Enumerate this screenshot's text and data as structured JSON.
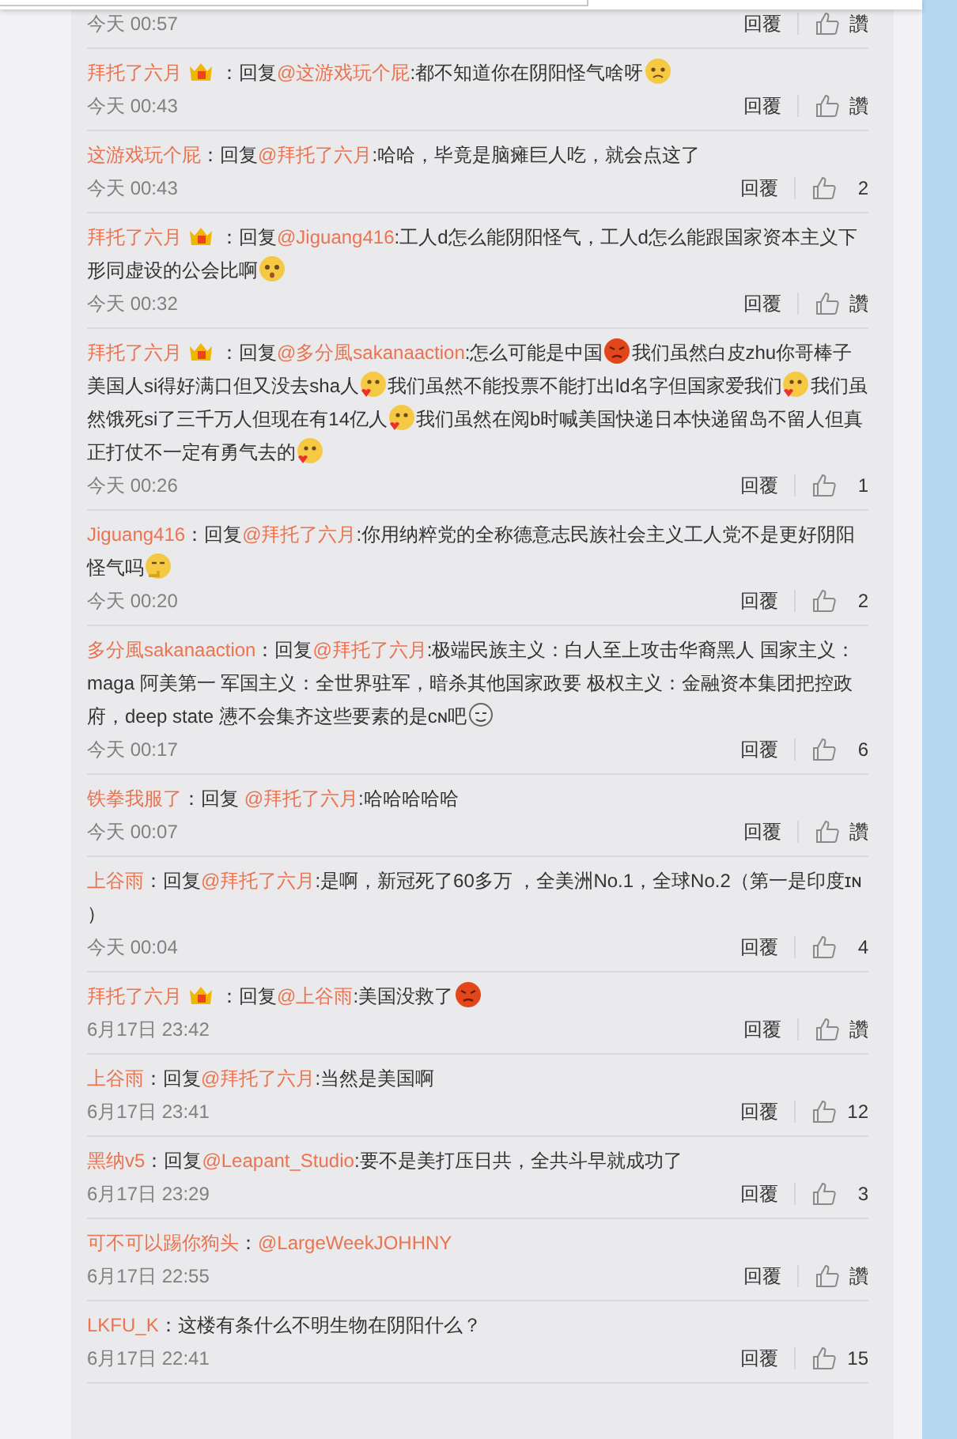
{
  "top_footer": {
    "time": "今天 00:57",
    "reply": "回覆",
    "likes": "讚"
  },
  "comments": [
    {
      "author": "拜托了六月",
      "badge": true,
      "segments": [
        {
          "kind": "text",
          "text": "：回复"
        },
        {
          "kind": "mention",
          "text": "@这游戏玩个屁"
        },
        {
          "kind": "text",
          "text": ":都不知道你在阴阳怪气啥呀"
        },
        {
          "kind": "sad"
        }
      ],
      "time": "今天 00:43",
      "reply": "回覆",
      "likes": "讚"
    },
    {
      "author": "这游戏玩个屁",
      "badge": false,
      "segments": [
        {
          "kind": "text",
          "text": "：回复"
        },
        {
          "kind": "mention",
          "text": "@拜托了六月"
        },
        {
          "kind": "text",
          "text": ":哈哈，毕竟是脑瘫巨人吃，就会点这了"
        }
      ],
      "time": "今天 00:43",
      "reply": "回覆",
      "likes": "2"
    },
    {
      "author": "拜托了六月",
      "badge": true,
      "segments": [
        {
          "kind": "text",
          "text": "：回复"
        },
        {
          "kind": "mention",
          "text": "@Jiguang416"
        },
        {
          "kind": "text",
          "text": ":工人d怎么能阴阳怪气，工人d怎么能跟国家资本主义下形同虚设的公会比啊"
        },
        {
          "kind": "shy"
        }
      ],
      "time": "今天 00:32",
      "reply": "回覆",
      "likes": "讚"
    },
    {
      "author": "拜托了六月",
      "badge": true,
      "segments": [
        {
          "kind": "text",
          "text": "：回复"
        },
        {
          "kind": "mention",
          "text": "@多分風sakanaaction"
        },
        {
          "kind": "text",
          "text": ":怎么可能是中国"
        },
        {
          "kind": "angry"
        },
        {
          "kind": "text",
          "text": "我们虽然白皮zhu你哥棒子美国人si得好满口但又没去sha人"
        },
        {
          "kind": "love"
        },
        {
          "kind": "text",
          "text": "我们虽然不能投票不能打出ld名字但国家爱我们"
        },
        {
          "kind": "love"
        },
        {
          "kind": "text",
          "text": "我们虽然饿死si了三千万人但现在有14亿人"
        },
        {
          "kind": "love"
        },
        {
          "kind": "text",
          "text": "我们虽然在阅b时喊美国快递日本快递留岛不留人但真正打仗不一定有勇气去的"
        },
        {
          "kind": "love"
        }
      ],
      "time": "今天 00:26",
      "reply": "回覆",
      "likes": "1"
    },
    {
      "author": "Jiguang416",
      "badge": false,
      "segments": [
        {
          "kind": "text",
          "text": "：回复"
        },
        {
          "kind": "mention",
          "text": "@拜托了六月"
        },
        {
          "kind": "text",
          "text": ":你用纳粹党的全称德意志民族社会主义工人党不是更好阴阳怪气吗"
        },
        {
          "kind": "think"
        }
      ],
      "time": "今天 00:20",
      "reply": "回覆",
      "likes": "2"
    },
    {
      "author": "多分風sakanaaction",
      "badge": false,
      "segments": [
        {
          "kind": "text",
          "text": "：回复"
        },
        {
          "kind": "mention",
          "text": "@拜托了六月"
        },
        {
          "kind": "text",
          "text": ":极端民族主义：白人至上攻击华裔黑人 国家主义：maga 阿美第一 军国主义：全世界驻军，暗杀其他国家政要 极权主义：金融资本集团把控政府，deep state 懑不会集齐这些要素的是ᴄɴ吧"
        },
        {
          "kind": "smirk"
        }
      ],
      "time": "今天 00:17",
      "reply": "回覆",
      "likes": "6"
    },
    {
      "author": "铁拳我服了",
      "badge": false,
      "segments": [
        {
          "kind": "text",
          "text": "：回复 "
        },
        {
          "kind": "mention",
          "text": "@拜托了六月"
        },
        {
          "kind": "text",
          "text": ":哈哈哈哈哈"
        }
      ],
      "time": "今天 00:07",
      "reply": "回覆",
      "likes": "讚"
    },
    {
      "author": "上谷雨",
      "badge": false,
      "segments": [
        {
          "kind": "text",
          "text": "：回复"
        },
        {
          "kind": "mention",
          "text": "@拜托了六月"
        },
        {
          "kind": "text",
          "text": ":是啊，新冠死了60多万 ，全美洲No.1，全球No.2（第一是印度ɪɴ ）"
        }
      ],
      "time": "今天 00:04",
      "reply": "回覆",
      "likes": "4"
    },
    {
      "author": "拜托了六月",
      "badge": true,
      "segments": [
        {
          "kind": "text",
          "text": "：回复"
        },
        {
          "kind": "mention",
          "text": "@上谷雨"
        },
        {
          "kind": "text",
          "text": ":美国没救了"
        },
        {
          "kind": "angry"
        }
      ],
      "time": "6月17日 23:42",
      "reply": "回覆",
      "likes": "讚"
    },
    {
      "author": "上谷雨",
      "badge": false,
      "segments": [
        {
          "kind": "text",
          "text": "：回复"
        },
        {
          "kind": "mention",
          "text": "@拜托了六月"
        },
        {
          "kind": "text",
          "text": ":当然是美国啊"
        }
      ],
      "time": "6月17日 23:41",
      "reply": "回覆",
      "likes": "12"
    },
    {
      "author": "黑纳v5",
      "badge": false,
      "segments": [
        {
          "kind": "text",
          "text": "：回复"
        },
        {
          "kind": "mention",
          "text": "@Leapant_Studio"
        },
        {
          "kind": "text",
          "text": ":要不是美打压日共，全共斗早就成功了"
        }
      ],
      "time": "6月17日 23:29",
      "reply": "回覆",
      "likes": "3"
    },
    {
      "author": "可不可以踢你狗头",
      "badge": false,
      "segments": [
        {
          "kind": "text",
          "text": "："
        },
        {
          "kind": "mention",
          "text": "@LargeWeekJOHHNY"
        }
      ],
      "time": "6月17日 22:55",
      "reply": "回覆",
      "likes": "讚"
    },
    {
      "author": "LKFU_K",
      "badge": false,
      "segments": [
        {
          "kind": "text",
          "text": "：这楼有条什么不明生物在阴阳什么？"
        }
      ],
      "time": "6月17日 22:41",
      "reply": "回覆",
      "likes": "15"
    }
  ]
}
